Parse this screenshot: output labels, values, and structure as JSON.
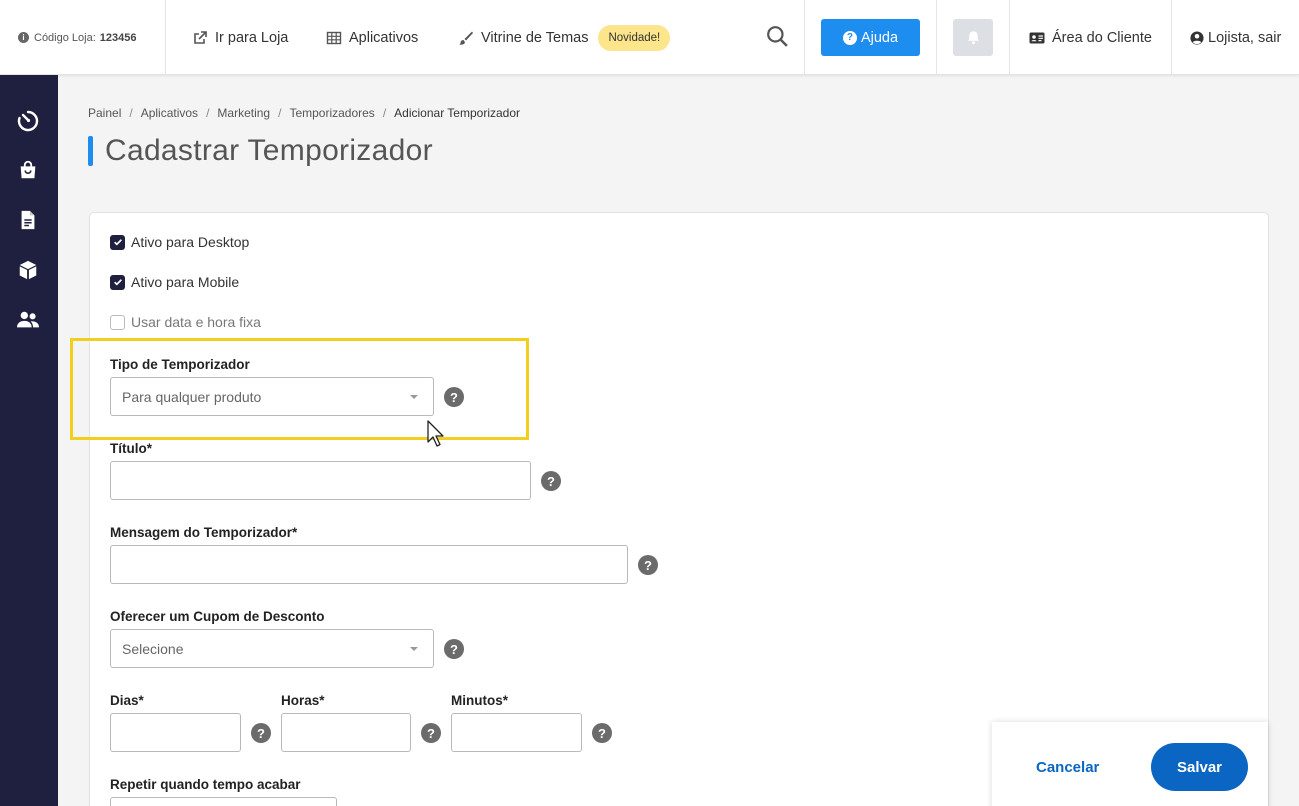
{
  "topbar": {
    "store_code_label": "Código Loja:",
    "store_code_value": "123456",
    "go_to_store": "Ir para Loja",
    "apps": "Aplicativos",
    "themes": "Vitrine de Temas",
    "new_badge": "Novidade!",
    "help": "Ajuda",
    "client_area": "Área do Cliente",
    "logout": "Lojista, sair"
  },
  "sidebar": {
    "icons": [
      "dashboard-icon",
      "shopping-bag-icon",
      "document-icon",
      "box-icon",
      "users-icon"
    ]
  },
  "breadcrumb": [
    "Painel",
    "Aplicativos",
    "Marketing",
    "Temporizadores",
    "Adicionar Temporizador"
  ],
  "page_title": "Cadastrar Temporizador",
  "form": {
    "active_desktop": "Ativo para Desktop",
    "active_mobile": "Ativo para Mobile",
    "fixed_datetime": "Usar data e hora fixa",
    "timer_type_label": "Tipo de Temporizador",
    "timer_type_value": "Para qualquer produto",
    "title_label": "Título*",
    "message_label": "Mensagem do Temporizador*",
    "coupon_label": "Oferecer um Cupom de Desconto",
    "coupon_value": "Selecione",
    "days_label": "Dias*",
    "hours_label": "Horas*",
    "minutes_label": "Minutos*",
    "repeat_label": "Repetir quando tempo acabar"
  },
  "actions": {
    "cancel": "Cancelar",
    "save": "Salvar"
  },
  "colors": {
    "primary": "#1e8df0",
    "sidebar": "#1f2040",
    "save": "#0a66c2",
    "highlight": "#f2cf1f",
    "badge": "#fce58a"
  }
}
